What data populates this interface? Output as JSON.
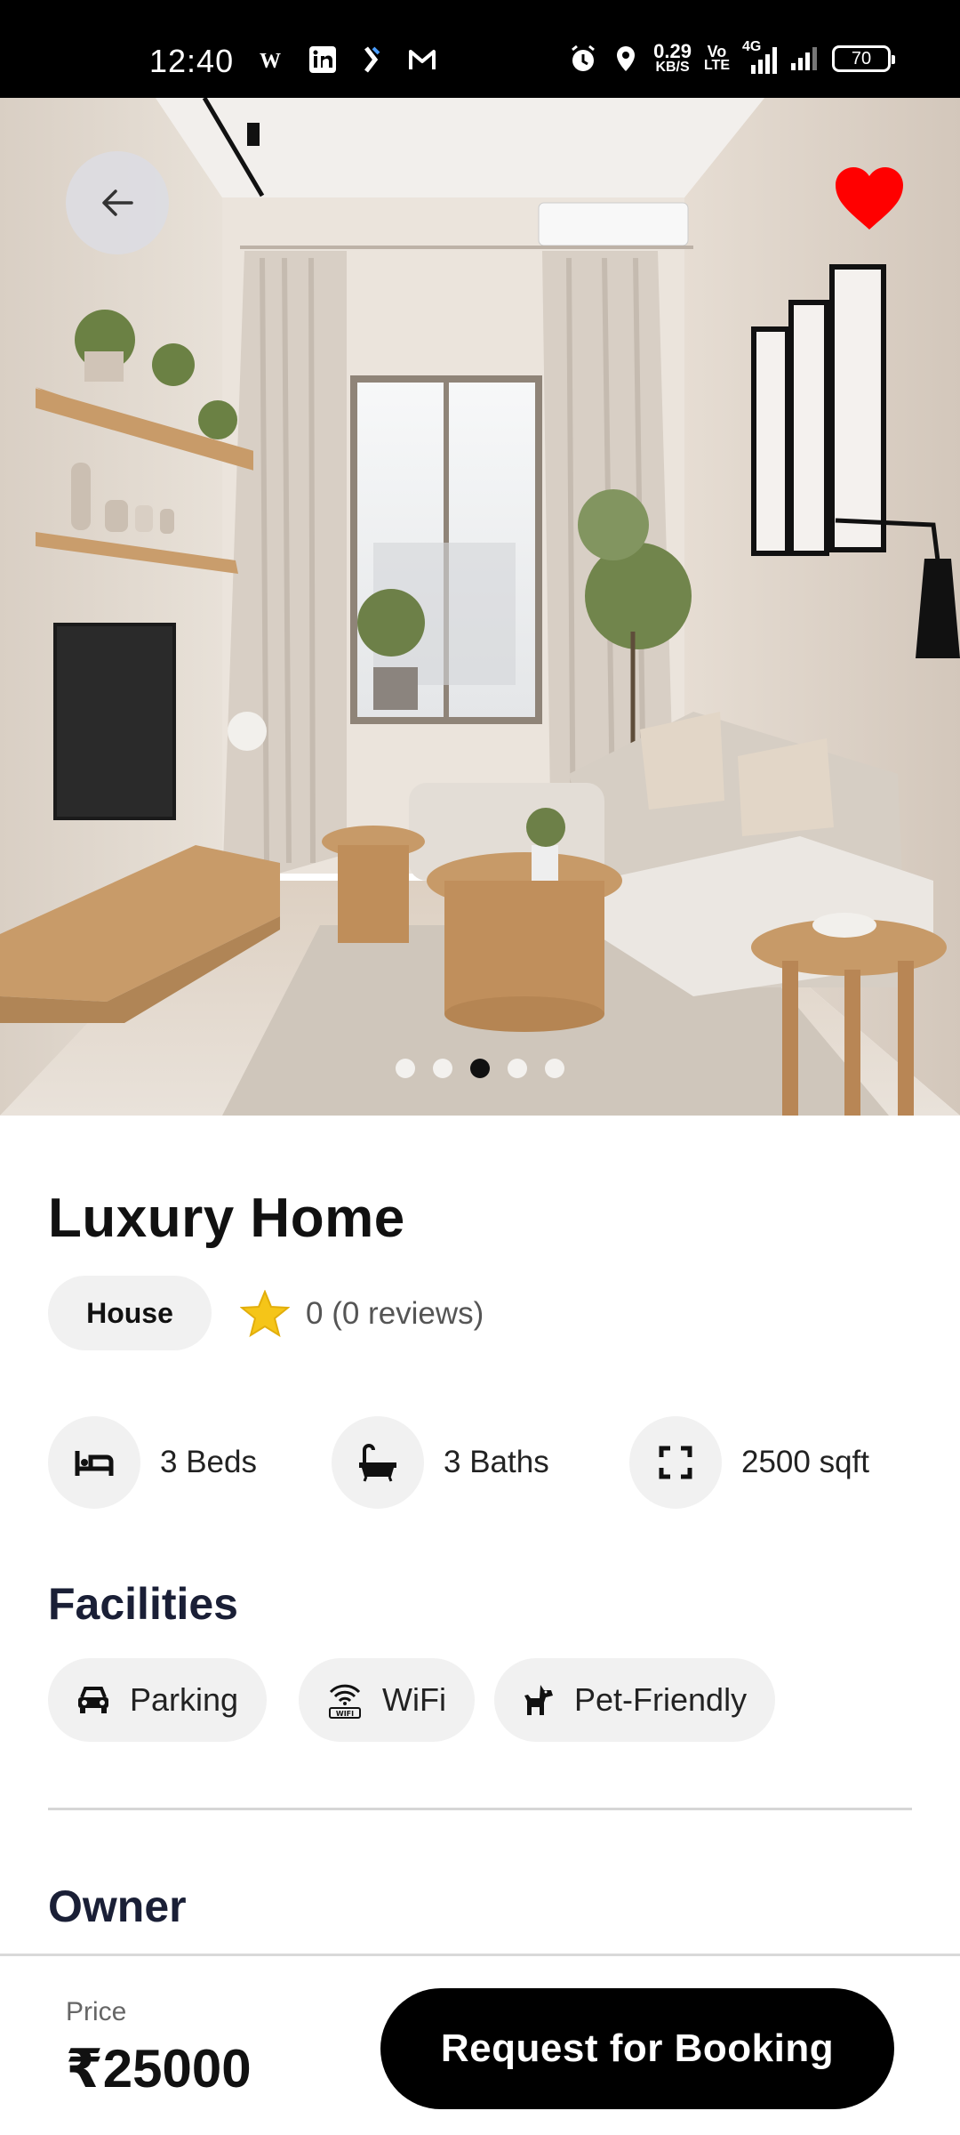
{
  "status_bar": {
    "time": "12:40",
    "net_speed_value": "0.29",
    "net_speed_unit": "KB/S",
    "volte_top": "Vo",
    "volte_bottom": "LTE",
    "network_type": "4G",
    "battery_level": "70"
  },
  "gallery": {
    "image_count": 5,
    "active_index": 2,
    "is_favorite": true,
    "favorite_color": "#ff0000"
  },
  "property": {
    "title": "Luxury Home",
    "type_label": "House",
    "rating_text": "0 (0 reviews)",
    "features": [
      {
        "icon": "bed-icon",
        "label": "3 Beds"
      },
      {
        "icon": "bathtub-icon",
        "label": "3 Baths"
      },
      {
        "icon": "expand-icon",
        "label": "2500 sqft"
      }
    ]
  },
  "facilities": {
    "heading": "Facilities",
    "items": [
      {
        "icon": "car-icon",
        "label": "Parking"
      },
      {
        "icon": "wifi-icon",
        "label": "WiFi"
      },
      {
        "icon": "dog-icon",
        "label": "Pet-Friendly"
      }
    ]
  },
  "owner": {
    "heading": "Owner"
  },
  "footer": {
    "price_label": "Price",
    "price_value": "₹25000",
    "book_button_label": "Request for Booking"
  },
  "colors": {
    "accent": "#000000",
    "chip_bg": "#f1f1f1",
    "heading_color": "#1a1f36",
    "star_color": "#f5c518"
  }
}
